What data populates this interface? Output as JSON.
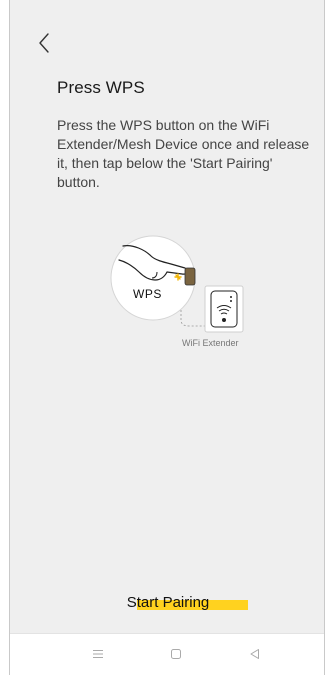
{
  "header": {
    "back_icon": "chevron-left-icon"
  },
  "content": {
    "title": "Press WPS",
    "description": "Press the WPS button on the WiFi Extender/Mesh Device once and release it, then tap below the 'Start Pairing' button.",
    "illustration": {
      "button_label": "WPS",
      "device_label": "WiFi Extender"
    }
  },
  "action": {
    "start_label": "Start Pairing",
    "highlight_color": "#ffd21f"
  },
  "navbar": {
    "items": [
      "menu-icon",
      "home-icon",
      "back-triangle-icon"
    ]
  }
}
